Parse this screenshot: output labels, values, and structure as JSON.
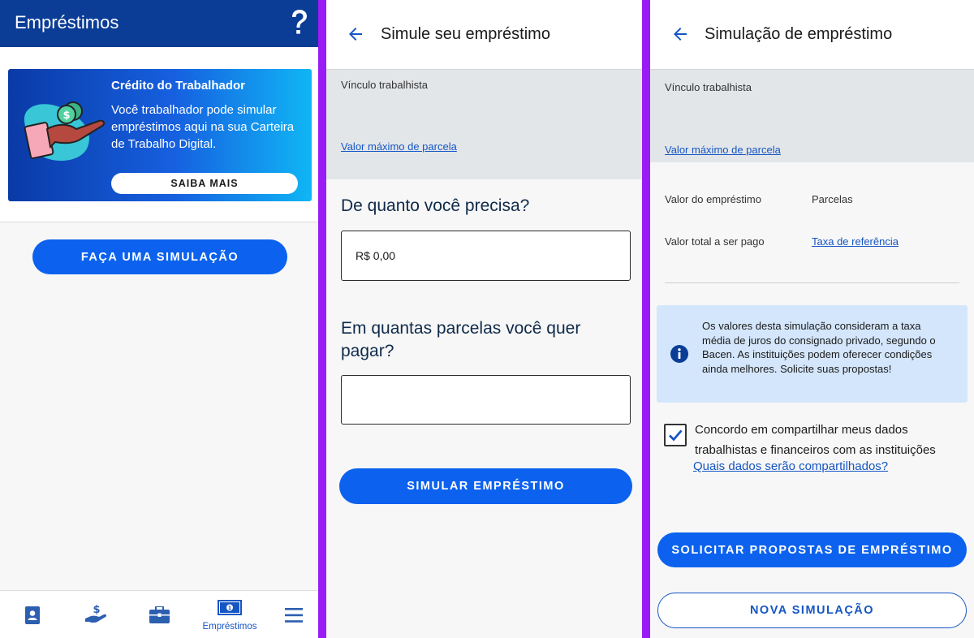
{
  "colors": {
    "header_blue": "#0b3d96",
    "primary_blue": "#0c62ee",
    "link_blue": "#1656c4",
    "divider_purple": "#9a1cf5",
    "info_bg": "#d4e6fb",
    "gray_block": "#e3e6e9"
  },
  "panel1": {
    "header_title": "Empréstimos",
    "help_icon": "question-mark-icon",
    "banner": {
      "title": "Crédito do Trabalhador",
      "text": "Você trabalhador pode simular empréstimos aqui na sua Carteira de Trabalho Digital.",
      "button_label": "SAIBA MAIS",
      "illustration": "hand-holding-coin-icon"
    },
    "simulate_button_label": "FAÇA UMA SIMULAÇÃO",
    "bottom_nav": [
      {
        "icon": "id-card-icon",
        "label": ""
      },
      {
        "icon": "hand-money-icon",
        "label": ""
      },
      {
        "icon": "briefcase-icon",
        "label": ""
      },
      {
        "icon": "banknote-icon",
        "label": "Empréstimos",
        "active": true
      },
      {
        "icon": "menu-icon",
        "label": ""
      }
    ]
  },
  "panel2": {
    "header_title": "Simule seu empréstimo",
    "vinculo_label": "Vínculo trabalhista",
    "max_parcela_link": "Valor máximo de parcela",
    "question_amount": "De quanto você precisa?",
    "amount_value": "R$ 0,00",
    "question_installments": "Em quantas parcelas você quer pagar?",
    "installments_value": "",
    "simulate_button_label": "SIMULAR EMPRÉSTIMO"
  },
  "panel3": {
    "header_title": "Simulação de empréstimo",
    "vinculo_label": "Vínculo trabalhista",
    "max_parcela_link": "Valor máximo de parcela",
    "loan_value_label": "Valor do empréstimo",
    "installments_label": "Parcelas",
    "total_label": "Valor total a ser pago",
    "rate_link": "Taxa de referência",
    "info_text": "Os valores desta simulação consideram a taxa média de juros do consignado privado, segundo o Bacen. As instituições podem oferecer condições ainda melhores. Solicite suas propostas!",
    "agree_text": "Concordo em compartilhar meus dados trabalhistas e financeiros com as instituições",
    "agree_link": "Quais dados serão compartilhados?",
    "agree_checked": true,
    "request_button_label": "SOLICITAR PROPOSTAS DE EMPRÉSTIMO",
    "new_sim_button_label": "NOVA SIMULAÇÃO"
  }
}
